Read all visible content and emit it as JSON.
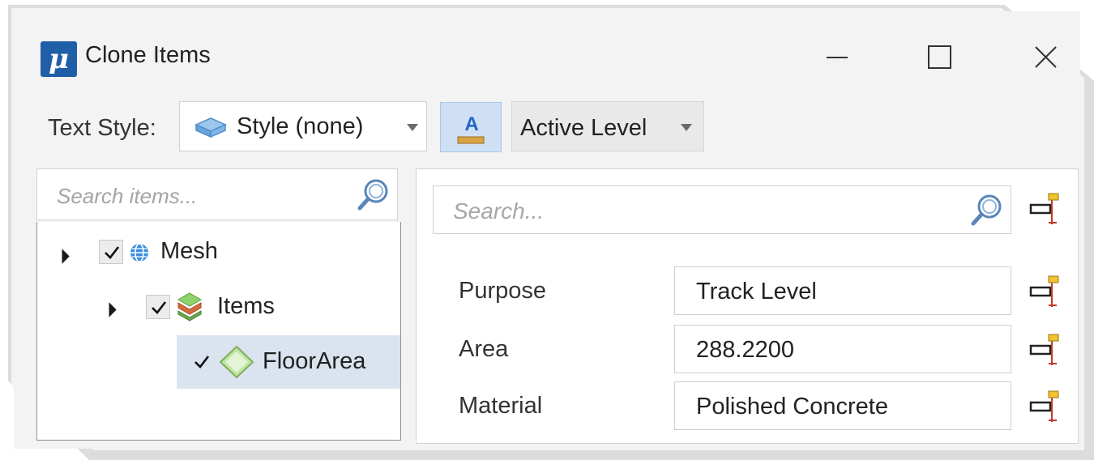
{
  "window": {
    "title": "Clone Items",
    "app_icon_glyph": "μ",
    "controls": [
      "minimize-icon",
      "maximize-icon",
      "close-icon"
    ]
  },
  "toolbar": {
    "text_style_label": "Text Style:",
    "style_value": "Style (none)",
    "style_icon": "text-style-icon",
    "text_format_icon": "text-format-icon",
    "level_value": "Active Level"
  },
  "tree": {
    "search_placeholder": "Search items...",
    "nodes": [
      {
        "label": "Mesh",
        "checked": true,
        "expanded": true,
        "icon": "globe-icon"
      },
      {
        "label": "Items",
        "checked": true,
        "expanded": true,
        "icon": "stack-icon"
      },
      {
        "label": "FloorArea",
        "checked": true,
        "selected": true,
        "icon": "diamond-icon"
      }
    ]
  },
  "properties": {
    "search_placeholder": "Search...",
    "rows": [
      {
        "label": "Purpose",
        "value": "Track Level"
      },
      {
        "label": "Area",
        "value": "288.2200"
      },
      {
        "label": "Material",
        "value": "Polished Concrete"
      }
    ]
  },
  "colors": {
    "accent": "#1f5fa8",
    "selected_row": "#dbe3ef",
    "dialog_bg": "#f3f3f3"
  }
}
